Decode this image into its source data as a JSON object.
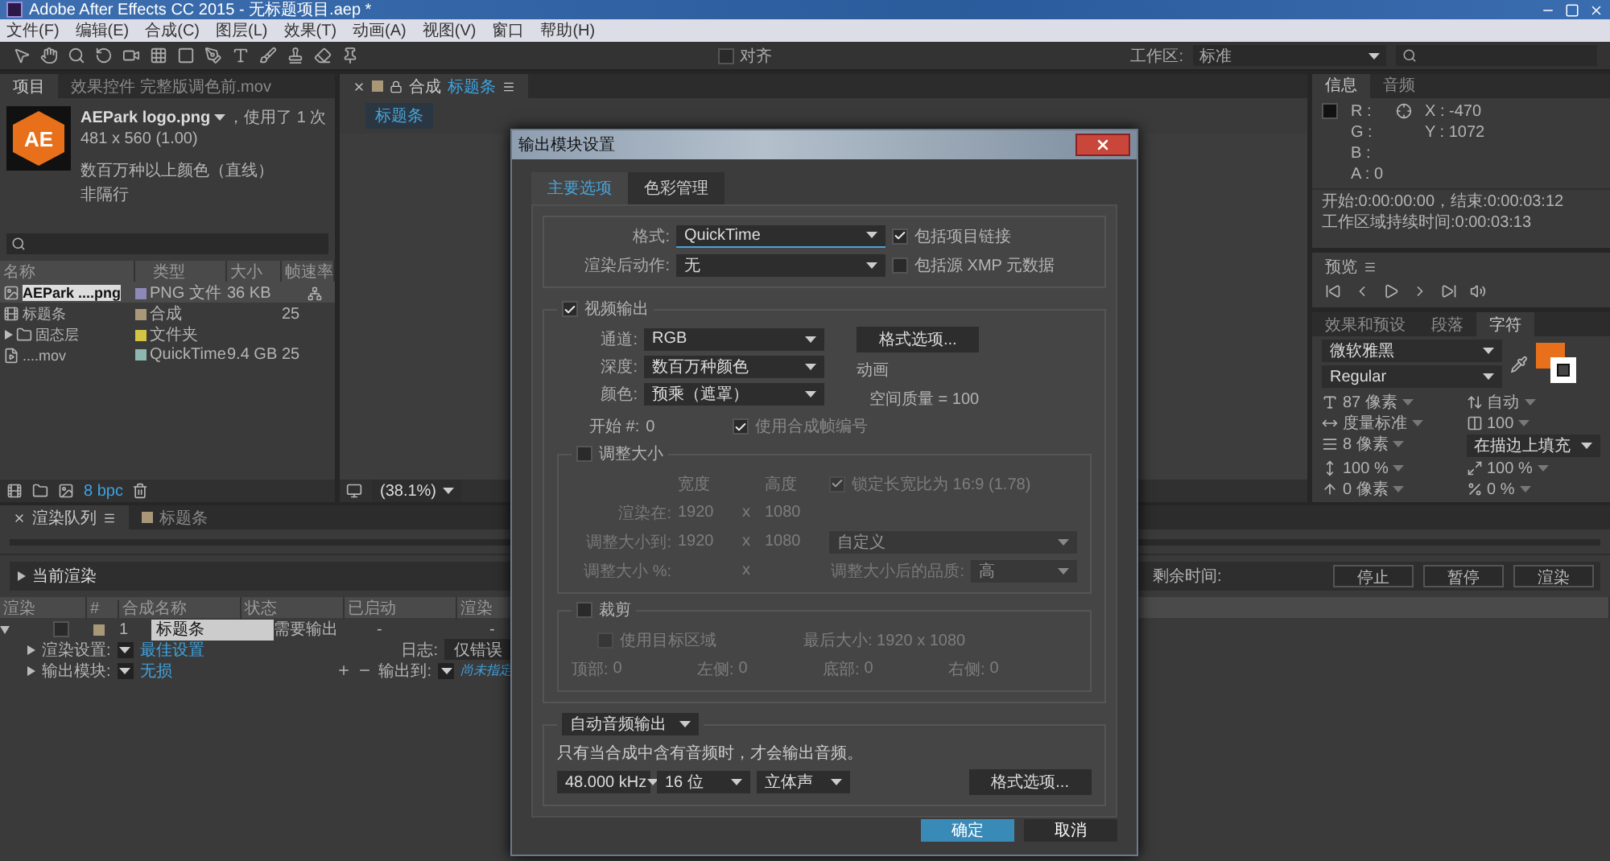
{
  "window": {
    "title": "Adobe After Effects CC 2015 - 无标题项目.aep *"
  },
  "menu": [
    "文件(F)",
    "编辑(E)",
    "合成(C)",
    "图层(L)",
    "效果(T)",
    "动画(A)",
    "视图(V)",
    "窗口",
    "帮助(H)"
  ],
  "toolbar": {
    "snap": {
      "label": "对齐",
      "checked": false
    },
    "workspace_label": "工作区:",
    "workspace": "标准"
  },
  "project": {
    "tabs": [
      {
        "label": "项目",
        "selected": true
      },
      {
        "label": "效果控件 完整版调色前.mov",
        "selected": false
      }
    ],
    "preview": {
      "logo": "AE",
      "name": "AEPark logo.png",
      "usage": "，使用了 1 次",
      "dimensions": "481 x 560 (1.00)",
      "colors": "数百万种以上颜色（直线）",
      "field_order": "非隔行"
    },
    "columns": [
      "名称",
      "类型",
      "大小",
      "帧速率"
    ],
    "rows": [
      {
        "kind": "image",
        "name": "AEPark ....png",
        "color": "#8c88b8",
        "type": "PNG 文件",
        "size": "36 KB",
        "selected": true
      },
      {
        "kind": "composition",
        "name": "标题条",
        "color": "#a89878",
        "type": "合成",
        "fps": "25",
        "selected": false
      },
      {
        "kind": "folder",
        "name": "固态层",
        "color": "#d4c444",
        "type": "文件夹",
        "expanded": false,
        "selected": false
      },
      {
        "kind": "video",
        "name": "....mov",
        "color": "#8cb8b0",
        "type": "QuickTime",
        "size": "9.4 GB",
        "fps": "25",
        "selected": false
      }
    ],
    "bit_depth": "8 bpc"
  },
  "composition": {
    "tab": "合成",
    "name": "标题条",
    "breadcrumb": "标题条",
    "zoom": "(38.1%)"
  },
  "info": {
    "tabs": [
      {
        "label": "信息",
        "selected": true
      },
      {
        "label": "音频",
        "selected": false
      }
    ],
    "channels": [
      "R :",
      "G :",
      "B :",
      "A : 0"
    ],
    "coords": [
      "X : -470",
      "Y : 1072"
    ],
    "lines": [
      "开始:0:00:00:00，结束:0:00:03:12",
      "工作区域持续时间:0:00:03:13"
    ]
  },
  "preview_panel": {
    "title": "预览"
  },
  "character": {
    "tabs": [
      {
        "label": "效果和预设",
        "selected": false
      },
      {
        "label": "段落",
        "selected": false
      },
      {
        "label": "字符",
        "selected": true
      }
    ],
    "font": "微软雅黑",
    "style": "Regular",
    "fields": [
      {
        "kind": "font_size",
        "value": "87 像素"
      },
      {
        "kind": "leading",
        "value": "自动"
      },
      {
        "kind": "kerning",
        "value": "度量标准"
      },
      {
        "kind": "tracking",
        "value": "100"
      },
      {
        "kind": "stroke_width",
        "value": "8 像素"
      },
      {
        "kind": "stroke_mode",
        "value": "在描边上填充"
      },
      {
        "kind": "vertical_scale",
        "value": "100 %"
      },
      {
        "kind": "horizontal_scale",
        "value": "100 %"
      },
      {
        "kind": "baseline_shift",
        "value": "0 像素"
      },
      {
        "kind": "tsume",
        "value": "0 %"
      }
    ]
  },
  "render_queue": {
    "tabs": [
      {
        "label": "渲染队列",
        "selected": true
      },
      {
        "label": "标题条",
        "selected": false
      }
    ],
    "current_render": "当前渲染",
    "time_left_label": "剩余时间:",
    "buttons": [
      "停止",
      "暂停",
      "渲染"
    ],
    "columns": [
      "渲染",
      "#",
      "合成名称",
      "状态",
      "已启动",
      "渲染"
    ],
    "items": [
      {
        "render": false,
        "expanded": true,
        "number": "1",
        "name": "标题条",
        "status": "需要输出",
        "started": "-",
        "render_time": "-",
        "settings": {
          "label": "渲染设置:",
          "value": "最佳设置",
          "log_label": "日志:",
          "log": "仅错误"
        },
        "output": {
          "label": "输出模块:",
          "value": "无损",
          "output_label": "输出到:",
          "output_to": "尚未指定"
        }
      }
    ]
  },
  "dialog": {
    "title": "输出模块设置",
    "tabs": [
      {
        "label": "主要选项",
        "selected": true
      },
      {
        "label": "色彩管理",
        "selected": false
      }
    ],
    "format": {
      "label": "格式:",
      "value": "QuickTime"
    },
    "post_render": {
      "label": "渲染后动作:",
      "value": "无"
    },
    "include_links": {
      "label": "包括项目链接",
      "checked": true
    },
    "include_xmp": {
      "label": "包括源 XMP 元数据",
      "checked": false
    },
    "video": {
      "label": "视频输出",
      "checked": true,
      "selects": [
        {
          "label": "通道:",
          "value": "RGB"
        },
        {
          "label": "深度:",
          "value": "数百万种颜色"
        },
        {
          "label": "颜色:",
          "value": "预乘（遮罩）"
        }
      ],
      "format_options": "格式选项...",
      "codec": "动画",
      "quality": "空间质量 = 100",
      "start_label": "开始 #:",
      "start": "0",
      "use_comp_frame": {
        "label": "使用合成帧编号",
        "checked": true
      }
    },
    "resize": {
      "label": "调整大小",
      "checked": false,
      "width_label": "宽度",
      "height_label": "高度",
      "lock": {
        "label": "锁定长宽比为 16:9 (1.78)",
        "checked": true
      },
      "render_label": "渲染在:",
      "render_w": "1920",
      "render_x": "x",
      "render_h": "1080",
      "to_label": "调整大小到:",
      "to_w": "1920",
      "to_x": "x",
      "to_h": "1080",
      "preset": "自定义",
      "percent_label": "调整大小 %:",
      "percent_x": "x",
      "quality_label": "调整大小后的品质:",
      "quality": "高"
    },
    "crop": {
      "label": "裁剪",
      "checked": false,
      "use_roi": {
        "label": "使用目标区域",
        "checked": false
      },
      "final_size": "最后大小: 1920 x 1080",
      "edges": [
        {
          "label": "顶部:",
          "value": "0"
        },
        {
          "label": "左侧:",
          "value": "0"
        },
        {
          "label": "底部:",
          "value": "0"
        },
        {
          "label": "右侧:",
          "value": "0"
        }
      ]
    },
    "audio": {
      "mode": "自动音频输出",
      "note": "只有当合成中含有音频时，才会输出音频。",
      "rate": "48.000 kHz",
      "depth": "16 位",
      "channels": "立体声",
      "format_options": "格式选项..."
    },
    "buttons": [
      {
        "label": "确定",
        "kind": "primary"
      },
      {
        "label": "取消",
        "kind": "secondary"
      }
    ]
  }
}
